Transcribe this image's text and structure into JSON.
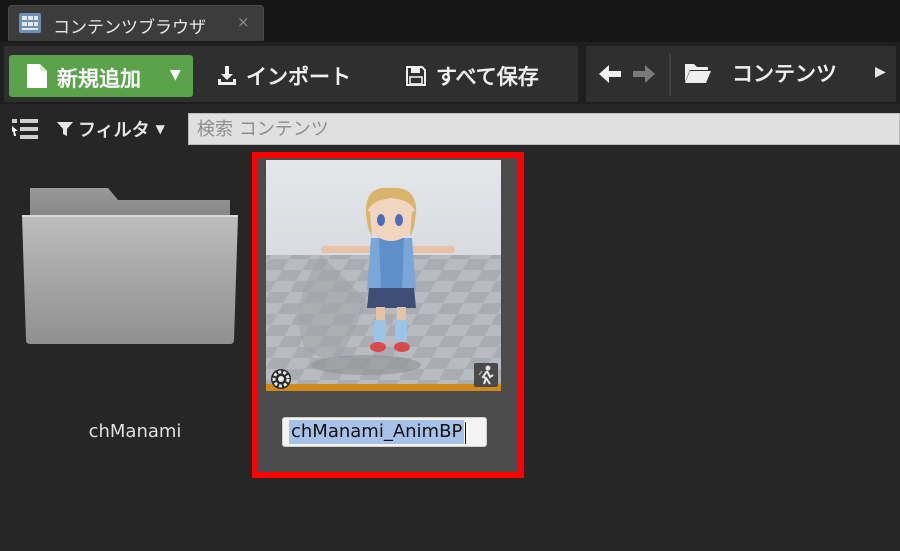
{
  "tab": {
    "title": "コンテンツブラウザ",
    "close": "×"
  },
  "toolbar": {
    "add_new_label": "新規追加",
    "import_label": "インポート",
    "save_all_label": "すべて保存",
    "path_label": "コンテンツ"
  },
  "filter": {
    "filters_label": "フィルタ",
    "search_placeholder": "検索 コンテンツ"
  },
  "items": [
    {
      "name": "chManami",
      "type": "folder"
    },
    {
      "name": "chManami_AnimBP",
      "type": "animation-blueprint",
      "renaming": true
    }
  ],
  "colors": {
    "add_button": "#5aa34b",
    "highlight": "#ff0000",
    "thumbnail_bar": "#d08a1c",
    "selection": "#a7c2e8"
  },
  "icons": [
    "content-browser-icon",
    "document-icon",
    "download-icon",
    "save-icon",
    "arrow-left-icon",
    "arrow-right-icon",
    "folder-open-icon",
    "list-view-icon",
    "funnel-icon",
    "gear-icon",
    "animation-icon"
  ]
}
